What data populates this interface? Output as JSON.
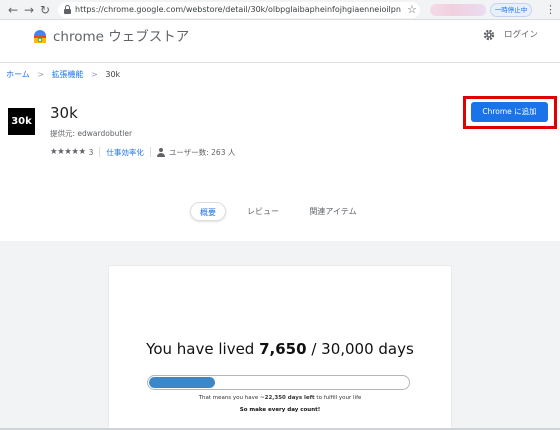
{
  "browser": {
    "url": "https://chrome.google.com/webstore/detail/30k/olbpglaibapheinfojhgiaenneioilpn",
    "pause_label": "一時停止中",
    "icons": [
      "back-arrow",
      "forward-arrow",
      "reload",
      "lock",
      "star",
      "kebab-menu"
    ]
  },
  "header": {
    "title": "chrome ウェブストア",
    "login_label": "ログイン",
    "icons": [
      "chrome-webstore-logo",
      "gear-icon"
    ]
  },
  "breadcrumb": {
    "items": [
      "ホーム",
      "拡張機能",
      "30k"
    ],
    "separator": ">"
  },
  "extension": {
    "icon_text": "30k",
    "name": "30k",
    "provider": "提供元: edwardobutler",
    "stars": "★★★★★",
    "rating_count": "3",
    "category": "仕事効率化",
    "users": "ユーザー数: 263 人",
    "add_button": "Chrome に追加"
  },
  "tabs": [
    {
      "label": "概要",
      "active": true
    },
    {
      "label": "レビュー",
      "active": false
    },
    {
      "label": "関連アイテム",
      "active": false
    }
  ],
  "screenshot": {
    "prefix": "You have lived ",
    "lived_days": "7,650",
    "suffix": " / 30,000 days",
    "progress_fraction": 0.255,
    "left_prefix": "That means you have ",
    "left_days": "~22,350 days left",
    "left_suffix": " to fulfill your life",
    "slogan": "So make every day count!"
  },
  "colors": {
    "accent": "#1a73e8",
    "highlight": "#e00000",
    "progress": "#3b87c8"
  }
}
